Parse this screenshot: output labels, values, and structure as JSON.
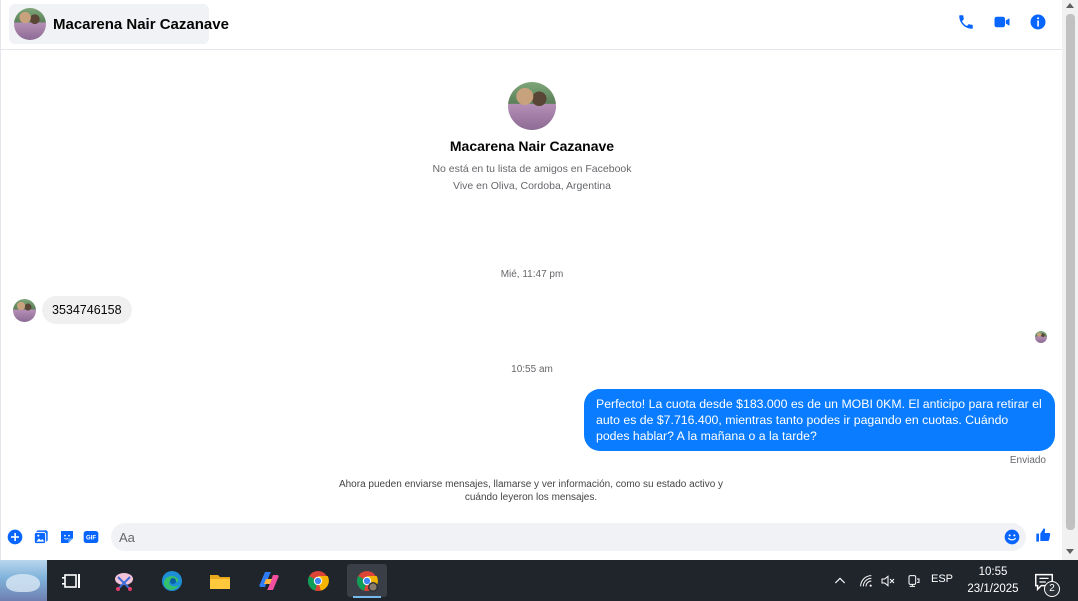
{
  "header": {
    "contact_name": "Macarena Nair Cazanave",
    "icons": [
      "phone-icon",
      "video-icon",
      "info-icon"
    ]
  },
  "profile": {
    "name": "Macarena Nair Cazanave",
    "friend_status": "No está en tu lista de amigos en Facebook",
    "location": "Vive en Oliva, Cordoba, Argentina"
  },
  "messages": [
    {
      "type": "timestamp",
      "text": "Mié, 11:47 pm"
    },
    {
      "type": "incoming",
      "text": "3534746158"
    },
    {
      "type": "timestamp",
      "text": "10:55 am"
    },
    {
      "type": "outgoing",
      "text": "Perfecto! La cuota desde $183.000 es de un MOBI 0KM. El anticipo para retirar el auto es de $7.716.400, mientras tanto podes ir pagando en cuotas. Cuándo podes hablar? A la mañana o a la tarde?",
      "status": "Enviado"
    }
  ],
  "notice": "Ahora pueden enviarse mensajes, llamarse y ver información, como su estado activo y cuándo leyeron los mensajes.",
  "composer": {
    "placeholder": "Aa",
    "value": "",
    "icons": [
      "plus-icon",
      "photo-icon",
      "sticker-icon",
      "gif-icon",
      "emoji-icon",
      "like-icon"
    ],
    "gif_label": "GIF"
  },
  "colors": {
    "accent": "#0a7cff",
    "icon_blue": "#0866ff",
    "incoming_bubble": "#f0f0f0",
    "taskbar": "#20242b"
  },
  "taskbar": {
    "apps": [
      "widgets-thumbnail",
      "task-view-icon",
      "snipping-tool-icon",
      "edge-icon",
      "file-explorer-icon",
      "copilot-icon",
      "chrome-icon",
      "chrome-profile-icon"
    ],
    "language": "ESP",
    "time": "10:55",
    "date": "23/1/2025",
    "notification_count": "2"
  }
}
